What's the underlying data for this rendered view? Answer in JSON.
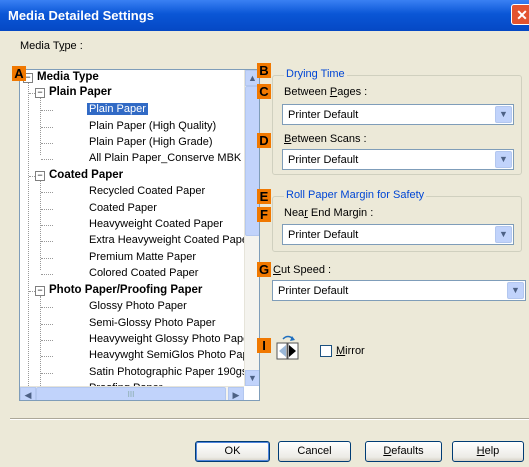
{
  "window": {
    "title": "Media Detailed Settings",
    "close_glyph": "✕"
  },
  "media_type_label": "Media Type :",
  "markers": {
    "a": "A",
    "b": "B",
    "c": "C",
    "d": "D",
    "e": "E",
    "f": "F",
    "g": "G",
    "i": "I"
  },
  "tree": {
    "root": "Media Type",
    "groups": [
      {
        "label": "Plain Paper",
        "items": [
          "Plain Paper",
          "Plain Paper (High Quality)",
          "Plain Paper (High Grade)",
          "All Plain Paper_Conserve MBK"
        ]
      },
      {
        "label": "Coated Paper",
        "items": [
          "Recycled Coated Paper",
          "Coated Paper",
          "Heavyweight Coated Paper",
          "Extra Heavyweight Coated Pape",
          "Premium Matte Paper",
          "Colored Coated Paper"
        ]
      },
      {
        "label": "Photo Paper/Proofing Paper",
        "items": [
          "Glossy Photo Paper",
          "Semi-Glossy Photo Paper",
          "Heavyweight Glossy Photo Pape",
          "Heavywght SemiGlos Photo Pap",
          "Satin Photographic Paper 190gs",
          "Proofing Paper"
        ]
      }
    ],
    "selected": "Plain Paper",
    "expand_glyph": "−",
    "scroll_up_glyph": "▲",
    "scroll_down_glyph": "▼",
    "scroll_left_glyph": "◀",
    "scroll_right_glyph": "▶"
  },
  "drying_time": {
    "title": "Drying Time",
    "between_pages_label": "Between Pages :",
    "between_pages_value": "Printer Default",
    "between_scans_label": "Between Scans :",
    "between_scans_value": "Printer Default"
  },
  "roll_margin": {
    "title": "Roll Paper Margin for Safety",
    "near_end_label": "Near End Margin :",
    "near_end_value": "Printer Default"
  },
  "cut_speed": {
    "label": "Cut Speed :",
    "value": "Printer Default"
  },
  "mirror": {
    "label": "Mirror",
    "checked": false,
    "icon": "mirror-icon"
  },
  "combo_glyph": "▼",
  "buttons": {
    "ok": "OK",
    "cancel": "Cancel",
    "defaults": "Defaults",
    "help": "Help"
  },
  "colors": {
    "accent": "#0a56d6",
    "marker": "#f07800",
    "group_title": "#0046d5",
    "selection": "#316ac5"
  }
}
